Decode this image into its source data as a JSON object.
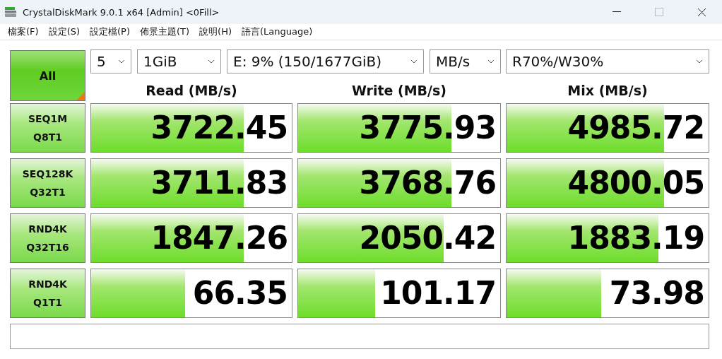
{
  "window": {
    "title": "CrystalDiskMark 9.0.1 x64 [Admin] <0Fill>"
  },
  "menu": [
    "檔案(F)",
    "設定(S)",
    "設定檔(P)",
    "佈景主題(T)",
    "說明(H)",
    "語言(Language)"
  ],
  "all_button": "All",
  "selectors": {
    "count": "5",
    "size": "1GiB",
    "drive": "E: 9% (150/1677GiB)",
    "unit": "MB/s",
    "mix": "R70%/W30%"
  },
  "columns": [
    "Read (MB/s)",
    "Write (MB/s)",
    "Mix (MB/s)"
  ],
  "rows": [
    {
      "test": "SEQ1M",
      "params": "Q8T1",
      "results": [
        {
          "value": "3722.45",
          "level": 0.76
        },
        {
          "value": "3775.93",
          "level": 0.76
        },
        {
          "value": "4985.72",
          "level": 0.78
        }
      ]
    },
    {
      "test": "SEQ128K",
      "params": "Q32T1",
      "results": [
        {
          "value": "3711.83",
          "level": 0.76
        },
        {
          "value": "3768.76",
          "level": 0.76
        },
        {
          "value": "4800.05",
          "level": 0.78
        }
      ]
    },
    {
      "test": "RND4K",
      "params": "Q32T16",
      "results": [
        {
          "value": "1847.26",
          "level": 0.76
        },
        {
          "value": "2050.42",
          "level": 0.72
        },
        {
          "value": "1883.19",
          "level": 0.75
        }
      ]
    },
    {
      "test": "RND4K",
      "params": "Q1T1",
      "results": [
        {
          "value": "66.35",
          "level": 0.47
        },
        {
          "value": "101.17",
          "level": 0.38
        },
        {
          "value": "73.98",
          "level": 0.47
        }
      ]
    }
  ]
}
